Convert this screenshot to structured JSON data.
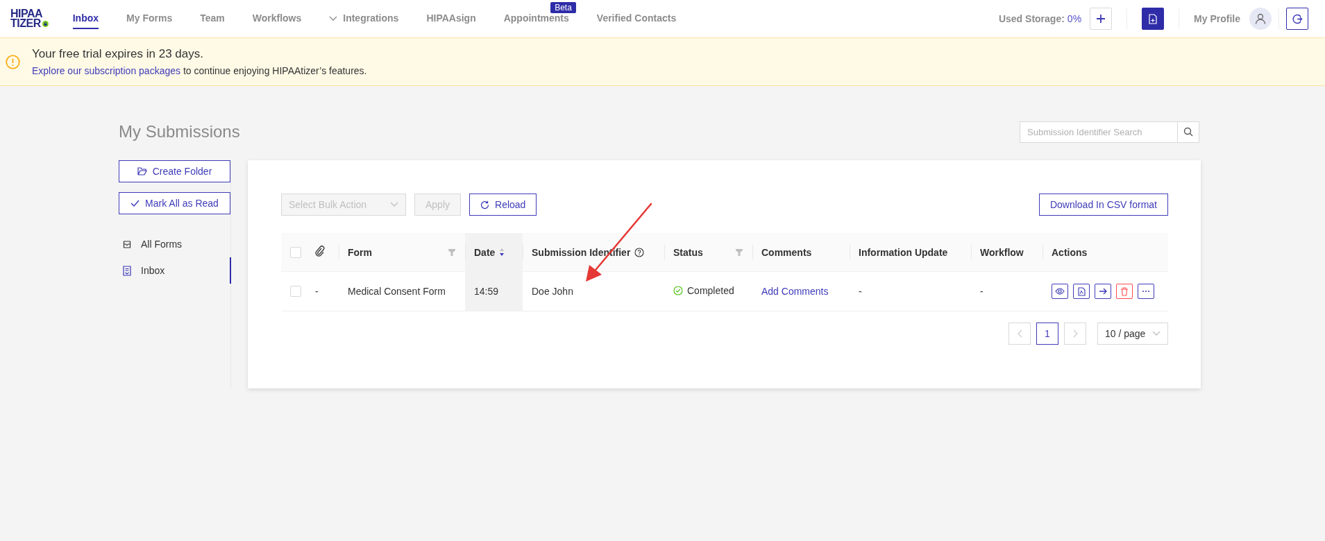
{
  "logo": {
    "lines": [
      "HIPAA",
      "TIZER"
    ]
  },
  "nav": {
    "items": [
      {
        "label": "Inbox",
        "selected": true,
        "dropdown": false
      },
      {
        "label": "My Forms",
        "selected": false,
        "dropdown": false
      },
      {
        "label": "Team",
        "selected": false,
        "dropdown": false
      },
      {
        "label": "Workflows",
        "selected": false,
        "dropdown": false
      },
      {
        "label": "Integrations",
        "selected": false,
        "dropdown": true
      },
      {
        "label": "HIPAAsign",
        "selected": false,
        "dropdown": false
      },
      {
        "label": "Appointments",
        "selected": false,
        "dropdown": false,
        "badge": "Beta"
      },
      {
        "label": "Verified Contacts",
        "selected": false,
        "dropdown": false
      }
    ]
  },
  "header_right": {
    "storage_label": "Used Storage:",
    "storage_value": "0%",
    "profile_label": "My Profile"
  },
  "banner": {
    "title": "Your free trial expires in 23 days.",
    "link": "Explore our subscription packages",
    "text": "to continue enjoying HIPAAtizer’s features."
  },
  "page": {
    "title": "My Submissions",
    "search": {
      "placeholder": "Submission Identifier Search"
    }
  },
  "sidebar": {
    "buttons": [
      {
        "label": "Create Folder",
        "kind": "folder"
      },
      {
        "label": "Mark All as Read",
        "kind": "check"
      }
    ],
    "items": [
      {
        "label": "All Forms",
        "kind": "all",
        "selected": false
      },
      {
        "label": "Inbox",
        "kind": "inbox",
        "selected": true
      }
    ]
  },
  "toolbar": {
    "bulk_action": {
      "placeholder": "Select Bulk Action",
      "disabled": true
    },
    "apply": {
      "label": "Apply",
      "disabled": true
    },
    "reload": {
      "label": "Reload"
    },
    "download": {
      "label": "Download In CSV format"
    }
  },
  "table": {
    "columns": [
      {
        "kind": "checkbox",
        "checked": false
      },
      {
        "kind": "attachment"
      },
      {
        "kind": "text",
        "label": "Form",
        "filter": true,
        "sorted": false,
        "help": false
      },
      {
        "kind": "text",
        "label": "Date",
        "filter": false,
        "sorted": true,
        "descending": true,
        "help": false
      },
      {
        "kind": "text",
        "label": "Submission Identifier",
        "filter": false,
        "sorted": false,
        "help": true
      },
      {
        "kind": "text",
        "label": "Status",
        "filter": true,
        "sorted": false,
        "help": false
      },
      {
        "kind": "text",
        "label": "Comments",
        "filter": false,
        "sorted": false,
        "help": false
      },
      {
        "kind": "text",
        "label": "Information Update",
        "filter": false,
        "sorted": false,
        "help": false
      },
      {
        "kind": "text",
        "label": "Workflow",
        "filter": false,
        "sorted": false,
        "help": false
      },
      {
        "kind": "text",
        "label": "Actions",
        "filter": false,
        "sorted": false,
        "help": false
      }
    ],
    "rows": [
      {
        "checked": false,
        "attachment": "-",
        "form": "Medical Consent Form",
        "date": "14:59",
        "identifier": "Doe John",
        "status": {
          "label": "Completed",
          "kind": "completed"
        },
        "comments": "Add Comments",
        "information_update": "-",
        "workflow": "-",
        "actions": [
          {
            "kind": "view"
          },
          {
            "kind": "pdf"
          },
          {
            "kind": "forward"
          },
          {
            "kind": "delete"
          },
          {
            "kind": "more"
          }
        ]
      }
    ]
  },
  "pagination": {
    "prev_disabled": true,
    "pages": [
      {
        "label": "1",
        "selected": true
      }
    ],
    "next_disabled": true,
    "page_size": "10 / page"
  }
}
